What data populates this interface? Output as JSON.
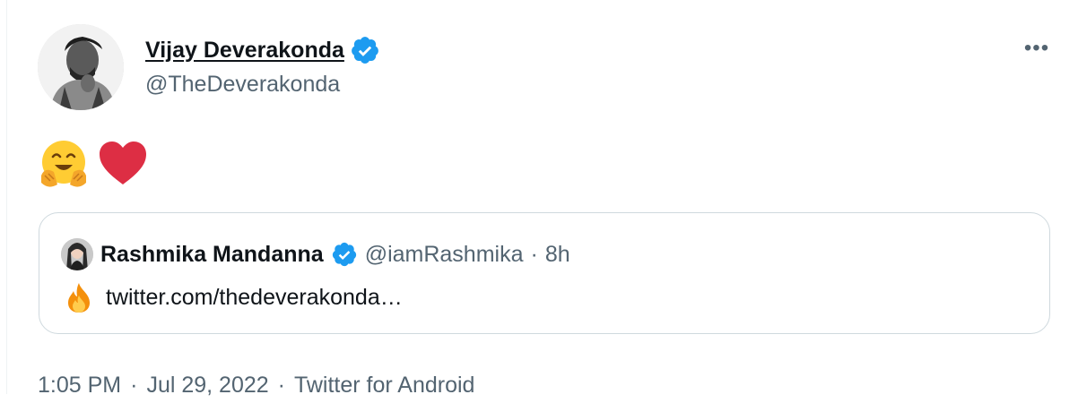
{
  "tweet": {
    "author": {
      "display_name": "Vijay Deverakonda",
      "handle": "@TheDeverakonda",
      "verified": true,
      "avatar_icon": "user-avatar-photo"
    },
    "more_icon": "more-horizontal-icon",
    "more_label": "•••",
    "body_emojis": [
      "hugging-face-emoji",
      "red-heart-emoji"
    ],
    "quote": {
      "display_name": "Rashmika Mandanna",
      "handle": "@iamRashmika",
      "separator": "·",
      "time": "8h",
      "verified": true,
      "body_emoji": "fire-emoji",
      "body_text": "twitter.com/thedeverakonda…"
    },
    "meta": {
      "time": "1:05 PM",
      "separator": "·",
      "date": "Jul 29, 2022",
      "separator2": "·",
      "source": "Twitter for Android"
    }
  },
  "colors": {
    "text_primary": "#0f1419",
    "text_secondary": "#536471",
    "verified_blue": "#1d9bf0",
    "border": "#cfd9de"
  }
}
